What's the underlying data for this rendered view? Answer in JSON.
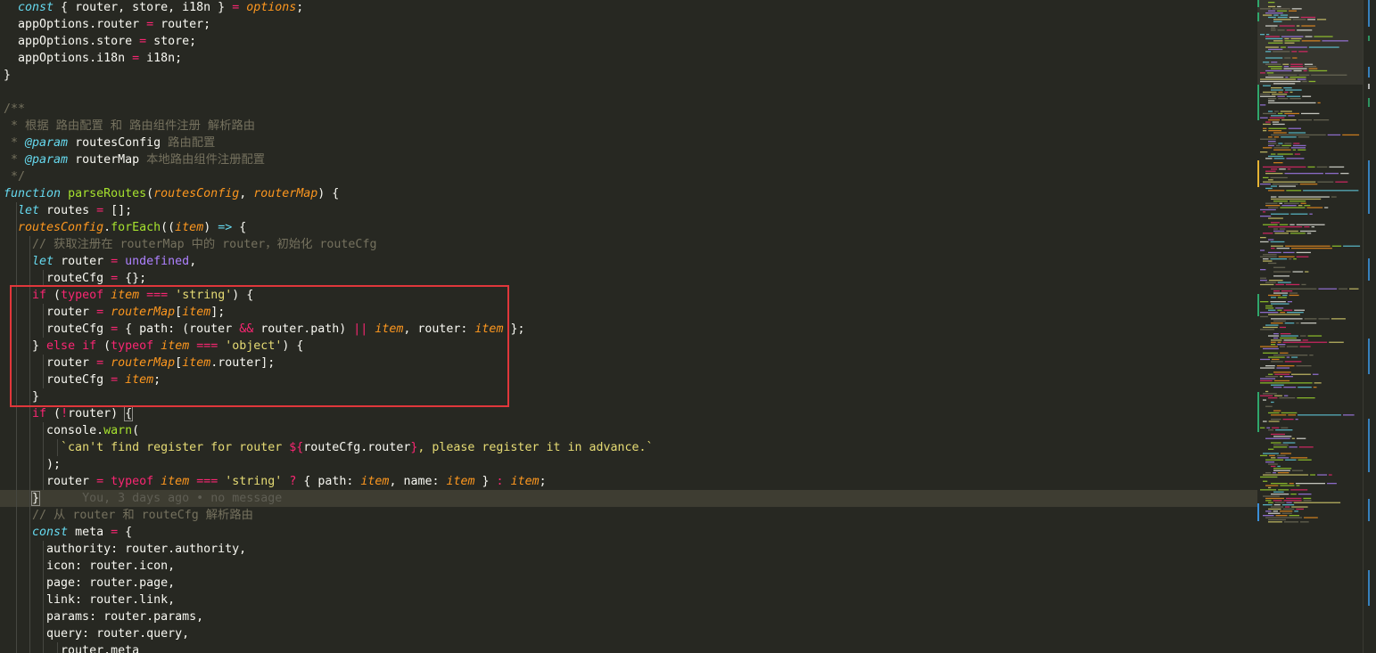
{
  "editor": {
    "blame_annotation": "You, 3 days ago • no message",
    "lines": [
      [
        [
          "  ",
          "t-var"
        ],
        [
          "const",
          "t-st"
        ],
        [
          " { router, store, i18n } ",
          "t-var"
        ],
        [
          "=",
          "t-kw"
        ],
        [
          " ",
          "t-var"
        ],
        [
          "options",
          "t-pa"
        ],
        [
          ";",
          "t-var"
        ]
      ],
      [
        [
          "  appOptions.router ",
          "t-var"
        ],
        [
          "=",
          "t-kw"
        ],
        [
          " router;",
          "t-var"
        ]
      ],
      [
        [
          "  appOptions.store ",
          "t-var"
        ],
        [
          "=",
          "t-kw"
        ],
        [
          " store;",
          "t-var"
        ]
      ],
      [
        [
          "  appOptions.i18n ",
          "t-var"
        ],
        [
          "=",
          "t-kw"
        ],
        [
          " i18n;",
          "t-var"
        ]
      ],
      [
        [
          "}",
          "t-var"
        ]
      ],
      [],
      [
        [
          "/**",
          "t-cm"
        ]
      ],
      [
        [
          " * 根据 路由配置 和 路由组件注册 解析路由",
          "t-cm"
        ]
      ],
      [
        [
          " * ",
          "t-cm"
        ],
        [
          "@param",
          "t-dk"
        ],
        [
          " routesConfig ",
          "t-dt"
        ],
        [
          "路由配置",
          "t-cm"
        ]
      ],
      [
        [
          " * ",
          "t-cm"
        ],
        [
          "@param",
          "t-dk"
        ],
        [
          " routerMap ",
          "t-dt"
        ],
        [
          "本地路由组件注册配置",
          "t-cm"
        ]
      ],
      [
        [
          " */",
          "t-cm"
        ]
      ],
      [
        [
          "function",
          "t-st"
        ],
        [
          " ",
          "t-var"
        ],
        [
          "parseRoutes",
          "t-fn"
        ],
        [
          "(",
          "t-var"
        ],
        [
          "routesConfig",
          "t-pa"
        ],
        [
          ", ",
          "t-var"
        ],
        [
          "routerMap",
          "t-pa"
        ],
        [
          ") {",
          "t-var"
        ]
      ],
      [
        [
          "  ",
          "t-var"
        ],
        [
          "let",
          "t-st"
        ],
        [
          " routes ",
          "t-var"
        ],
        [
          "=",
          "t-kw"
        ],
        [
          " [];",
          "t-var"
        ]
      ],
      [
        [
          "  ",
          "t-var"
        ],
        [
          "routesConfig",
          "t-pa"
        ],
        [
          ".",
          "t-var"
        ],
        [
          "forEach",
          "t-fn"
        ],
        [
          "((",
          "t-var"
        ],
        [
          "item",
          "t-pa"
        ],
        [
          ") ",
          "t-var"
        ],
        [
          "=>",
          "t-st"
        ],
        [
          " {",
          "t-var"
        ]
      ],
      [
        [
          "    // 获取注册在 routerMap 中的 router，初始化 routeCfg",
          "t-cm"
        ]
      ],
      [
        [
          "    ",
          "t-var"
        ],
        [
          "let",
          "t-st"
        ],
        [
          " router ",
          "t-var"
        ],
        [
          "=",
          "t-kw"
        ],
        [
          " ",
          "t-var"
        ],
        [
          "undefined",
          "t-ct"
        ],
        [
          ",",
          "t-var"
        ]
      ],
      [
        [
          "      routeCfg ",
          "t-var"
        ],
        [
          "=",
          "t-kw"
        ],
        [
          " {};",
          "t-var"
        ]
      ],
      [
        [
          "    ",
          "t-var"
        ],
        [
          "if",
          "t-kw"
        ],
        [
          " (",
          "t-var"
        ],
        [
          "typeof",
          "t-kw"
        ],
        [
          " ",
          "t-var"
        ],
        [
          "item",
          "t-pa"
        ],
        [
          " ",
          "t-var"
        ],
        [
          "===",
          "t-kw"
        ],
        [
          " ",
          "t-var"
        ],
        [
          "'string'",
          "t-str"
        ],
        [
          ") {",
          "t-var"
        ]
      ],
      [
        [
          "      router ",
          "t-var"
        ],
        [
          "=",
          "t-kw"
        ],
        [
          " ",
          "t-var"
        ],
        [
          "routerMap",
          "t-pa"
        ],
        [
          "[",
          "t-var"
        ],
        [
          "item",
          "t-pa"
        ],
        [
          "];",
          "t-var"
        ]
      ],
      [
        [
          "      routeCfg ",
          "t-var"
        ],
        [
          "=",
          "t-kw"
        ],
        [
          " { path: (router ",
          "t-var"
        ],
        [
          "&&",
          "t-kw"
        ],
        [
          " router.path) ",
          "t-var"
        ],
        [
          "||",
          "t-kw"
        ],
        [
          " ",
          "t-var"
        ],
        [
          "item",
          "t-pa"
        ],
        [
          ", router: ",
          "t-var"
        ],
        [
          "item",
          "t-pa"
        ],
        [
          " };",
          "t-var"
        ]
      ],
      [
        [
          "    } ",
          "t-var"
        ],
        [
          "else",
          "t-kw"
        ],
        [
          " ",
          "t-var"
        ],
        [
          "if",
          "t-kw"
        ],
        [
          " (",
          "t-var"
        ],
        [
          "typeof",
          "t-kw"
        ],
        [
          " ",
          "t-var"
        ],
        [
          "item",
          "t-pa"
        ],
        [
          " ",
          "t-var"
        ],
        [
          "===",
          "t-kw"
        ],
        [
          " ",
          "t-var"
        ],
        [
          "'object'",
          "t-str"
        ],
        [
          ") {",
          "t-var"
        ]
      ],
      [
        [
          "      router ",
          "t-var"
        ],
        [
          "=",
          "t-kw"
        ],
        [
          " ",
          "t-var"
        ],
        [
          "routerMap",
          "t-pa"
        ],
        [
          "[",
          "t-var"
        ],
        [
          "item",
          "t-pa"
        ],
        [
          ".router];",
          "t-var"
        ]
      ],
      [
        [
          "      routeCfg ",
          "t-var"
        ],
        [
          "=",
          "t-kw"
        ],
        [
          " ",
          "t-var"
        ],
        [
          "item",
          "t-pa"
        ],
        [
          ";",
          "t-var"
        ]
      ],
      [
        [
          "    }",
          "t-var"
        ]
      ],
      [
        [
          "    ",
          "t-var"
        ],
        [
          "if",
          "t-kw"
        ],
        [
          " (",
          "t-var"
        ],
        [
          "!",
          "t-kw"
        ],
        [
          "router) ",
          "t-var"
        ],
        [
          "{",
          "t-bm"
        ]
      ],
      [
        [
          "      console.",
          "t-var"
        ],
        [
          "warn",
          "t-fn"
        ],
        [
          "(",
          "t-var"
        ]
      ],
      [
        [
          "        ",
          "t-var"
        ],
        [
          "`can't find register for router ",
          "t-str"
        ],
        [
          "${",
          "t-kw"
        ],
        [
          "routeCfg.router",
          "t-var"
        ],
        [
          "}",
          "t-kw"
        ],
        [
          ", please register it in advance.`",
          "t-str"
        ]
      ],
      [
        [
          "      );",
          "t-var"
        ]
      ],
      [
        [
          "      router ",
          "t-var"
        ],
        [
          "=",
          "t-kw"
        ],
        [
          " ",
          "t-var"
        ],
        [
          "typeof",
          "t-kw"
        ],
        [
          " ",
          "t-var"
        ],
        [
          "item",
          "t-pa"
        ],
        [
          " ",
          "t-var"
        ],
        [
          "===",
          "t-kw"
        ],
        [
          " ",
          "t-var"
        ],
        [
          "'string'",
          "t-str"
        ],
        [
          " ",
          "t-var"
        ],
        [
          "?",
          "t-kw"
        ],
        [
          " { path: ",
          "t-var"
        ],
        [
          "item",
          "t-pa"
        ],
        [
          ", name: ",
          "t-var"
        ],
        [
          "item",
          "t-pa"
        ],
        [
          " } ",
          "t-var"
        ],
        [
          ":",
          "t-kw"
        ],
        [
          " ",
          "t-var"
        ],
        [
          "item",
          "t-pa"
        ],
        [
          ";",
          "t-var"
        ]
      ],
      [
        [
          "    ",
          "t-var"
        ],
        [
          "}",
          "t-bm"
        ],
        [
          "      ",
          "t-var"
        ],
        [
          "@@BLAME@@",
          "t-blame"
        ]
      ],
      [
        [
          "    // 从 router 和 routeCfg 解析路由",
          "t-cm"
        ]
      ],
      [
        [
          "    ",
          "t-var"
        ],
        [
          "const",
          "t-st"
        ],
        [
          " meta ",
          "t-var"
        ],
        [
          "=",
          "t-kw"
        ],
        [
          " {",
          "t-var"
        ]
      ],
      [
        [
          "      authority: router.authority,",
          "t-var"
        ]
      ],
      [
        [
          "      icon: router.icon,",
          "t-var"
        ]
      ],
      [
        [
          "      page: router.page,",
          "t-var"
        ]
      ],
      [
        [
          "      link: router.link,",
          "t-var"
        ]
      ],
      [
        [
          "      params: router.params,",
          "t-var"
        ]
      ],
      [
        [
          "      query: router.query,",
          "t-var"
        ]
      ],
      [
        [
          "        router.meta",
          "t-var"
        ]
      ]
    ],
    "current_line": 29
  }
}
